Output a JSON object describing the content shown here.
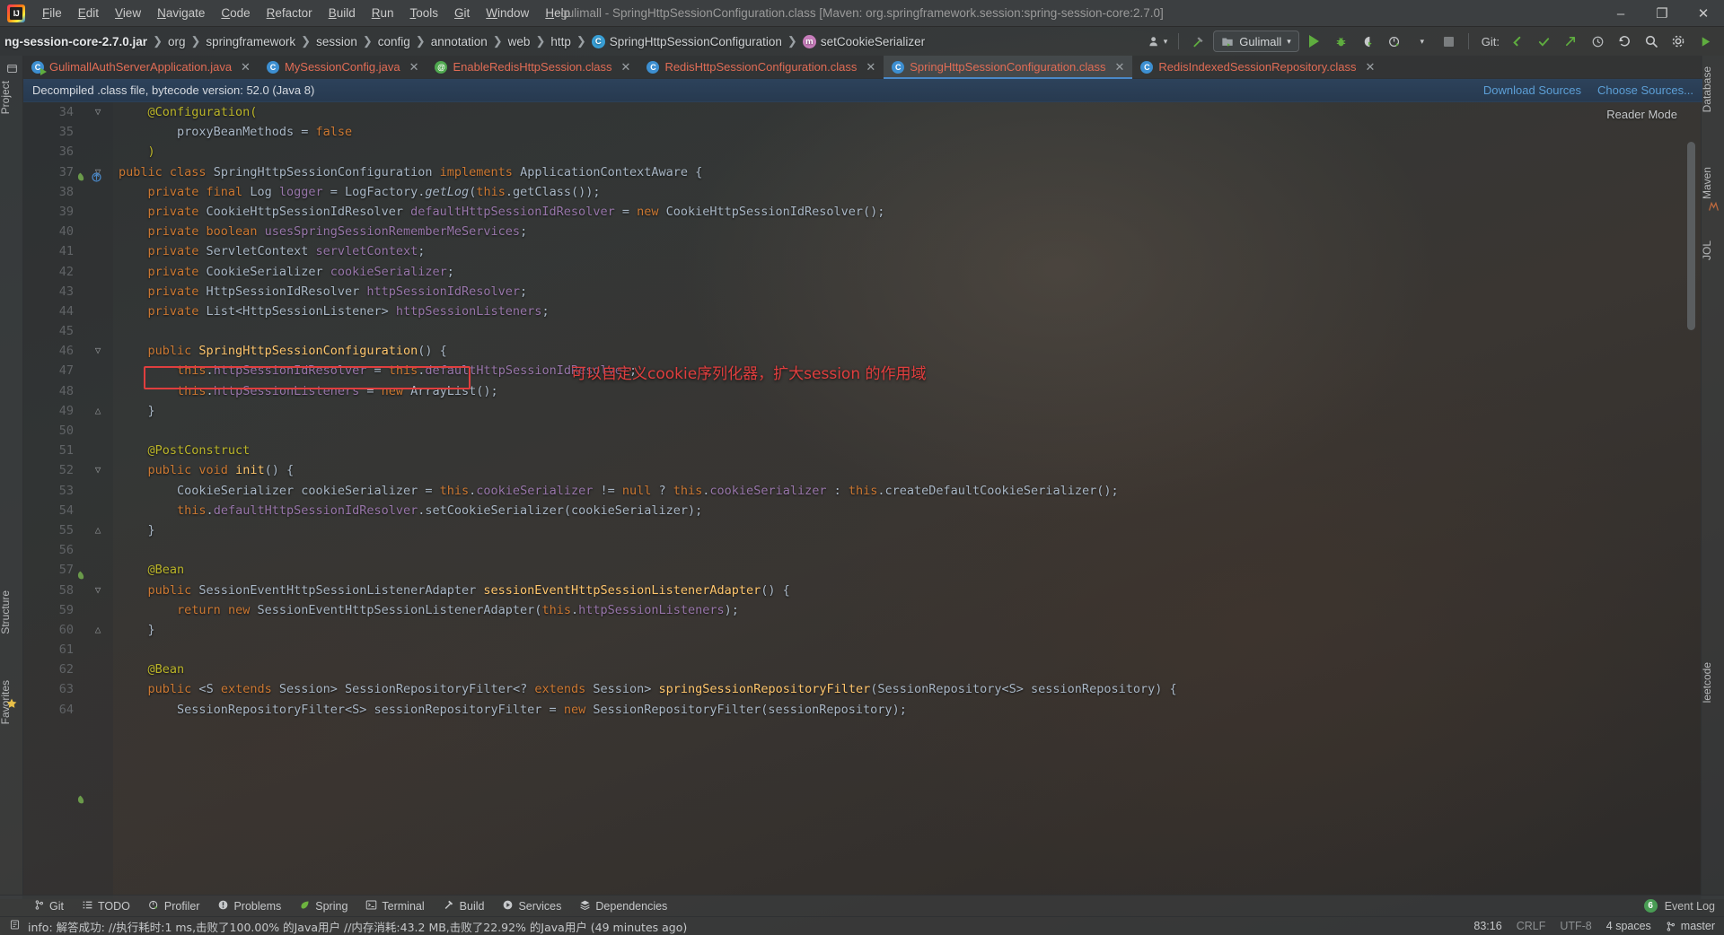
{
  "window": {
    "app_icon": "intellij-logo-icon",
    "title": "gulimall - SpringHttpSessionConfiguration.class [Maven: org.springframework.session:spring-session-core:2.7.0]",
    "minimize": "–",
    "maximize": "❐",
    "close": "✕"
  },
  "menu": [
    {
      "label": "File"
    },
    {
      "label": "Edit"
    },
    {
      "label": "View"
    },
    {
      "label": "Navigate"
    },
    {
      "label": "Code"
    },
    {
      "label": "Refactor"
    },
    {
      "label": "Build"
    },
    {
      "label": "Run"
    },
    {
      "label": "Tools"
    },
    {
      "label": "Git"
    },
    {
      "label": "Window"
    },
    {
      "label": "Help"
    }
  ],
  "breadcrumbs": [
    {
      "label": "ng-session-core-2.7.0.jar",
      "kind": "jar"
    },
    {
      "label": "org",
      "kind": "pkg"
    },
    {
      "label": "springframework",
      "kind": "pkg"
    },
    {
      "label": "session",
      "kind": "pkg"
    },
    {
      "label": "config",
      "kind": "pkg"
    },
    {
      "label": "annotation",
      "kind": "pkg"
    },
    {
      "label": "web",
      "kind": "pkg"
    },
    {
      "label": "http",
      "kind": "pkg"
    },
    {
      "label": "SpringHttpSessionConfiguration",
      "kind": "class",
      "badge": "C"
    },
    {
      "label": "setCookieSerializer",
      "kind": "method",
      "badge": "m"
    }
  ],
  "toolbar": {
    "avatar_icon": "user-avatar-icon",
    "avatar_chevron": "▾",
    "build_icon": "hammer-icon",
    "run_config_icon": "module-icon",
    "run_config_label": "Gulimall",
    "run_config_chevron": "▾",
    "run_icon": "run-play-icon",
    "debug_icon": "debug-bug-icon",
    "run_with_coverage_icon": "coverage-icon",
    "profile_icon": "profiler-icon",
    "profile_chevron": "▾",
    "stop_icon": "stop-square-icon",
    "git_label": "Git:",
    "git_update_icon": "git-update-icon",
    "git_commit_icon": "git-commit-check-icon",
    "git_push_icon": "git-push-icon",
    "history_icon": "history-clock-icon",
    "undo_icon": "undo-arrow-icon",
    "search_icon": "search-magnifier-icon",
    "settings_icon": "gear-icon",
    "play_green_icon": "play-green-icon"
  },
  "tabs": [
    {
      "label": "GulimallAuthServerApplication.java",
      "icon": "java-run-icon",
      "selected": false,
      "close": "✕"
    },
    {
      "label": "MySessionConfig.java",
      "icon": "java-class-icon",
      "selected": false,
      "close": "✕"
    },
    {
      "label": "EnableRedisHttpSession.class",
      "icon": "annotation-class-icon",
      "selected": false,
      "close": "✕"
    },
    {
      "label": "RedisHttpSessionConfiguration.class",
      "icon": "java-class-icon",
      "selected": false,
      "close": "✕"
    },
    {
      "label": "SpringHttpSessionConfiguration.class",
      "icon": "java-class-icon",
      "selected": true,
      "close": "✕"
    },
    {
      "label": "RedisIndexedSessionRepository.class",
      "icon": "java-class-icon",
      "selected": false,
      "close": "✕"
    }
  ],
  "banner": {
    "message": "Decompiled .class file, bytecode version: 52.0 (Java 8)",
    "download_sources": "Download Sources",
    "choose_sources": "Choose Sources..."
  },
  "editor": {
    "reader_mode": "Reader Mode",
    "annotation_cn": "可以自定义cookie序列化器，扩大session 的作用域",
    "lines": [
      {
        "num": 34,
        "fold": "▽",
        "tokens": [
          {
            "t": "@Configuration(",
            "c": "ann"
          }
        ],
        "indent": 1
      },
      {
        "num": 35,
        "fold": "",
        "tokens": [
          {
            "t": "proxyBeanMethods",
            "c": "pln"
          },
          {
            "t": " = ",
            "c": "pln"
          },
          {
            "t": "false",
            "c": "kw"
          }
        ],
        "indent": 2
      },
      {
        "num": 36,
        "fold": "",
        "tokens": [
          {
            "t": ")",
            "c": "ann"
          }
        ],
        "indent": 1
      },
      {
        "num": 37,
        "fold": "▽",
        "tokens": [
          {
            "t": "public ",
            "c": "kw"
          },
          {
            "t": "class ",
            "c": "kw"
          },
          {
            "t": "SpringHttpSessionConfiguration ",
            "c": "pln"
          },
          {
            "t": "implements ",
            "c": "kw"
          },
          {
            "t": "ApplicationContextAware {",
            "c": "pln"
          }
        ],
        "indent": 0
      },
      {
        "num": 38,
        "fold": "",
        "tokens": [
          {
            "t": "private ",
            "c": "kw"
          },
          {
            "t": "final ",
            "c": "kw"
          },
          {
            "t": "Log ",
            "c": "pln"
          },
          {
            "t": "logger",
            "c": "fld"
          },
          {
            "t": " = LogFactory.",
            "c": "pln"
          },
          {
            "t": "getLog",
            "c": "stat"
          },
          {
            "t": "(",
            "c": "pln"
          },
          {
            "t": "this",
            "c": "kw"
          },
          {
            "t": ".getClass());",
            "c": "pln"
          }
        ],
        "indent": 1
      },
      {
        "num": 39,
        "fold": "",
        "tokens": [
          {
            "t": "private ",
            "c": "kw"
          },
          {
            "t": "CookieHttpSessionIdResolver ",
            "c": "pln"
          },
          {
            "t": "defaultHttpSessionIdResolver",
            "c": "fld"
          },
          {
            "t": " = ",
            "c": "pln"
          },
          {
            "t": "new ",
            "c": "kw"
          },
          {
            "t": "CookieHttpSessionIdResolver();",
            "c": "pln"
          }
        ],
        "indent": 1
      },
      {
        "num": 40,
        "fold": "",
        "tokens": [
          {
            "t": "private ",
            "c": "kw"
          },
          {
            "t": "boolean ",
            "c": "kw"
          },
          {
            "t": "usesSpringSessionRememberMeServices",
            "c": "fld"
          },
          {
            "t": ";",
            "c": "pln"
          }
        ],
        "indent": 1
      },
      {
        "num": 41,
        "fold": "",
        "tokens": [
          {
            "t": "private ",
            "c": "kw"
          },
          {
            "t": "ServletContext ",
            "c": "pln"
          },
          {
            "t": "servletContext",
            "c": "fld"
          },
          {
            "t": ";",
            "c": "pln"
          }
        ],
        "indent": 1
      },
      {
        "num": 42,
        "fold": "",
        "tokens": [
          {
            "t": "private ",
            "c": "kw"
          },
          {
            "t": "CookieSerializer ",
            "c": "pln"
          },
          {
            "t": "cookieSerializer",
            "c": "fld"
          },
          {
            "t": ";",
            "c": "pln"
          }
        ],
        "indent": 1,
        "boxed": true
      },
      {
        "num": 43,
        "fold": "",
        "tokens": [
          {
            "t": "private ",
            "c": "kw"
          },
          {
            "t": "HttpSessionIdResolver ",
            "c": "pln"
          },
          {
            "t": "httpSessionIdResolver",
            "c": "fld"
          },
          {
            "t": ";",
            "c": "pln"
          }
        ],
        "indent": 1
      },
      {
        "num": 44,
        "fold": "",
        "tokens": [
          {
            "t": "private ",
            "c": "kw"
          },
          {
            "t": "List<HttpSessionListener> ",
            "c": "pln"
          },
          {
            "t": "httpSessionListeners",
            "c": "fld"
          },
          {
            "t": ";",
            "c": "pln"
          }
        ],
        "indent": 1
      },
      {
        "num": 45,
        "fold": "",
        "tokens": [],
        "indent": 1
      },
      {
        "num": 46,
        "fold": "▽",
        "tokens": [
          {
            "t": "public ",
            "c": "kw"
          },
          {
            "t": "SpringHttpSessionConfiguration",
            "c": "mth"
          },
          {
            "t": "() {",
            "c": "pln"
          }
        ],
        "indent": 1
      },
      {
        "num": 47,
        "fold": "",
        "tokens": [
          {
            "t": "this",
            "c": "kw"
          },
          {
            "t": ".",
            "c": "pln"
          },
          {
            "t": "httpSessionIdResolver",
            "c": "fld"
          },
          {
            "t": " = ",
            "c": "pln"
          },
          {
            "t": "this",
            "c": "kw"
          },
          {
            "t": ".",
            "c": "pln"
          },
          {
            "t": "defaultHttpSessionIdResolver",
            "c": "fld"
          },
          {
            "t": ";",
            "c": "pln"
          }
        ],
        "indent": 2
      },
      {
        "num": 48,
        "fold": "",
        "tokens": [
          {
            "t": "this",
            "c": "kw"
          },
          {
            "t": ".",
            "c": "pln"
          },
          {
            "t": "httpSessionListeners",
            "c": "fld"
          },
          {
            "t": " = ",
            "c": "pln"
          },
          {
            "t": "new ",
            "c": "kw"
          },
          {
            "t": "ArrayList();",
            "c": "pln"
          }
        ],
        "indent": 2
      },
      {
        "num": 49,
        "fold": "△",
        "tokens": [
          {
            "t": "}",
            "c": "pln"
          }
        ],
        "indent": 1
      },
      {
        "num": 50,
        "fold": "",
        "tokens": [],
        "indent": 1
      },
      {
        "num": 51,
        "fold": "",
        "tokens": [
          {
            "t": "@PostConstruct",
            "c": "ann"
          }
        ],
        "indent": 1
      },
      {
        "num": 52,
        "fold": "▽",
        "tokens": [
          {
            "t": "public ",
            "c": "kw"
          },
          {
            "t": "void ",
            "c": "kw"
          },
          {
            "t": "init",
            "c": "mth"
          },
          {
            "t": "() {",
            "c": "pln"
          }
        ],
        "indent": 1
      },
      {
        "num": 53,
        "fold": "",
        "tokens": [
          {
            "t": "CookieSerializer cookieSerializer = ",
            "c": "pln"
          },
          {
            "t": "this",
            "c": "kw"
          },
          {
            "t": ".",
            "c": "pln"
          },
          {
            "t": "cookieSerializer",
            "c": "fld"
          },
          {
            "t": " != ",
            "c": "pln"
          },
          {
            "t": "null",
            "c": "kw"
          },
          {
            "t": " ? ",
            "c": "pln"
          },
          {
            "t": "this",
            "c": "kw"
          },
          {
            "t": ".",
            "c": "pln"
          },
          {
            "t": "cookieSerializer",
            "c": "fld"
          },
          {
            "t": " : ",
            "c": "pln"
          },
          {
            "t": "this",
            "c": "kw"
          },
          {
            "t": ".createDefaultCookieSerializer();",
            "c": "pln"
          }
        ],
        "indent": 2
      },
      {
        "num": 54,
        "fold": "",
        "tokens": [
          {
            "t": "this",
            "c": "kw"
          },
          {
            "t": ".",
            "c": "pln"
          },
          {
            "t": "defaultHttpSessionIdResolver",
            "c": "fld"
          },
          {
            "t": ".setCookieSerializer(cookieSerializer);",
            "c": "pln"
          }
        ],
        "indent": 2
      },
      {
        "num": 55,
        "fold": "△",
        "tokens": [
          {
            "t": "}",
            "c": "pln"
          }
        ],
        "indent": 1
      },
      {
        "num": 56,
        "fold": "",
        "tokens": [],
        "indent": 1
      },
      {
        "num": 57,
        "fold": "",
        "tokens": [
          {
            "t": "@Bean",
            "c": "ann"
          }
        ],
        "indent": 1,
        "bean": true
      },
      {
        "num": 58,
        "fold": "▽",
        "tokens": [
          {
            "t": "public ",
            "c": "kw"
          },
          {
            "t": "SessionEventHttpSessionListenerAdapter ",
            "c": "pln"
          },
          {
            "t": "sessionEventHttpSessionListenerAdapter",
            "c": "mth"
          },
          {
            "t": "() {",
            "c": "pln"
          }
        ],
        "indent": 1
      },
      {
        "num": 59,
        "fold": "",
        "tokens": [
          {
            "t": "return ",
            "c": "kw"
          },
          {
            "t": "new ",
            "c": "kw"
          },
          {
            "t": "SessionEventHttpSessionListenerAdapter(",
            "c": "pln"
          },
          {
            "t": "this",
            "c": "kw"
          },
          {
            "t": ".",
            "c": "pln"
          },
          {
            "t": "httpSessionListeners",
            "c": "fld"
          },
          {
            "t": ");",
            "c": "pln"
          }
        ],
        "indent": 2
      },
      {
        "num": 60,
        "fold": "△",
        "tokens": [
          {
            "t": "}",
            "c": "pln"
          }
        ],
        "indent": 1
      },
      {
        "num": 61,
        "fold": "",
        "tokens": [],
        "indent": 1
      },
      {
        "num": 62,
        "fold": "",
        "tokens": [
          {
            "t": "@Bean",
            "c": "ann"
          }
        ],
        "indent": 1,
        "bean": true
      },
      {
        "num": 63,
        "fold": "",
        "tokens": [
          {
            "t": "public ",
            "c": "kw"
          },
          {
            "t": "<",
            "c": "pln"
          },
          {
            "t": "S ",
            "c": "pln"
          },
          {
            "t": "extends ",
            "c": "kw"
          },
          {
            "t": "Session> SessionRepositoryFilter<? ",
            "c": "pln"
          },
          {
            "t": "extends ",
            "c": "kw"
          },
          {
            "t": "Session> ",
            "c": "pln"
          },
          {
            "t": "springSessionRepositoryFilter",
            "c": "mth"
          },
          {
            "t": "(SessionRepository<S> sessionRepository) {",
            "c": "pln"
          }
        ],
        "indent": 1
      },
      {
        "num": 64,
        "fold": "",
        "tokens": [
          {
            "t": "SessionRepositoryFilter<S> sessionRepositoryFilter = ",
            "c": "pln"
          },
          {
            "t": "new ",
            "c": "kw"
          },
          {
            "t": "SessionRepositoryFilter(sessionRepository);",
            "c": "pln"
          }
        ],
        "indent": 2
      }
    ]
  },
  "left_strip": [
    {
      "label": "Project",
      "name": "tool-window-project"
    },
    {
      "label": "Structure",
      "name": "tool-window-structure"
    },
    {
      "label": "Favorites",
      "name": "tool-window-favorites"
    }
  ],
  "right_strip": [
    {
      "label": "Database",
      "name": "tool-window-database"
    },
    {
      "label": "Maven",
      "name": "tool-window-maven"
    },
    {
      "label": "JOL",
      "name": "tool-window-jol"
    },
    {
      "label": "leetcode",
      "name": "tool-window-leetcode"
    }
  ],
  "bottom_bar": {
    "items": [
      {
        "label": "Git",
        "icon": "git-branch-icon"
      },
      {
        "label": "TODO",
        "icon": "todo-list-icon"
      },
      {
        "label": "Profiler",
        "icon": "profiler-icon"
      },
      {
        "label": "Problems",
        "icon": "problems-warning-icon"
      },
      {
        "label": "Spring",
        "icon": "spring-leaf-icon"
      },
      {
        "label": "Terminal",
        "icon": "terminal-icon"
      },
      {
        "label": "Build",
        "icon": "hammer-icon"
      },
      {
        "label": "Services",
        "icon": "services-play-icon"
      },
      {
        "label": "Dependencies",
        "icon": "dependencies-layers-icon"
      }
    ],
    "event_log_count": "6",
    "event_log_label": "Event Log"
  },
  "status_bar": {
    "left_icon": "memory-indicator-icon",
    "message": "info: 解答成功: //执行耗时:1 ms,击败了100.00% 的Java用户 //内存消耗:43.2 MB,击败了22.92% 的Java用户 (49 minutes ago)",
    "caret_position": "83:16",
    "line_separator": "CRLF",
    "encoding": "UTF-8",
    "indent": "4 spaces",
    "branch": "master",
    "branch_icon": "git-branch-icon"
  },
  "colors": {
    "accent_blue": "#4a88c7",
    "tab_text": "#e06c55",
    "annotation_red": "#e03e3e",
    "keyword_orange": "#cc7832",
    "field_purple": "#9876aa",
    "method_yellow": "#ffc66d",
    "annotation_yellow": "#bbb529",
    "plain_text": "#a9b7c6",
    "green_run": "#5fad3f",
    "banner_blue": "#2c435e"
  }
}
